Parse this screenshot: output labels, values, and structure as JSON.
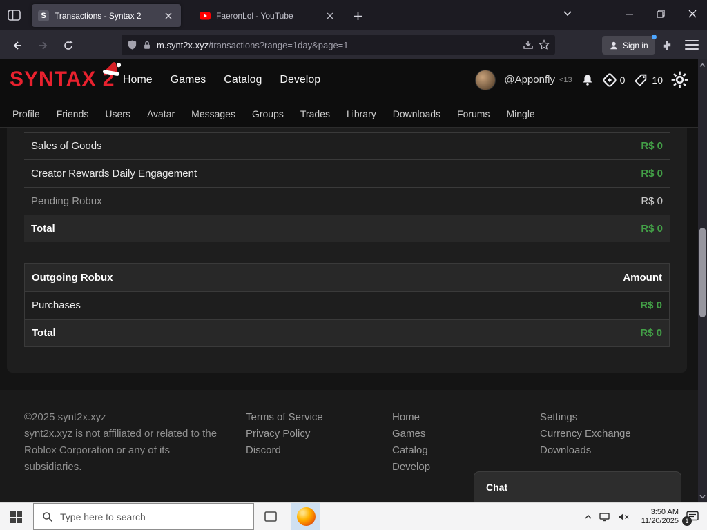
{
  "browser": {
    "tab1": {
      "favicon_letter": "S",
      "title": "Transactions - Syntax 2"
    },
    "tab2": {
      "title": "FaeronLol - YouTube"
    },
    "url_domain": "m.synt2x.xyz",
    "url_path": "/transactions?range=1day&page=1",
    "sign_in": "Sign in"
  },
  "header": {
    "logo": "SYNTAX 2",
    "nav": [
      "Home",
      "Games",
      "Catalog",
      "Develop"
    ],
    "username": "@Apponfly",
    "age_badge": "<13",
    "robux_count": "0",
    "tix_count": "10"
  },
  "subnav": [
    "Profile",
    "Friends",
    "Users",
    "Avatar",
    "Messages",
    "Groups",
    "Trades",
    "Library",
    "Downloads",
    "Forums",
    "Mingle"
  ],
  "transactions": {
    "incoming": {
      "rows": [
        {
          "label": "Sales of Goods",
          "value": "R$ 0"
        },
        {
          "label": "Creator Rewards Daily Engagement",
          "value": "R$ 0"
        },
        {
          "label": "Pending Robux",
          "value": "R$ 0"
        },
        {
          "label": "Total",
          "value": "R$ 0"
        }
      ]
    },
    "outgoing": {
      "header": {
        "label": "Outgoing Robux",
        "amount": "Amount"
      },
      "rows": [
        {
          "label": "Purchases",
          "value": "R$ 0"
        },
        {
          "label": "Total",
          "value": "R$ 0"
        }
      ]
    }
  },
  "footer": {
    "copyright": "©2025 synt2x.xyz",
    "disclaimer": "synt2x.xyz is not affiliated or related to the Roblox Corporation or any of its subsidiaries.",
    "legal": [
      "Terms of Service",
      "Privacy Policy",
      "Discord"
    ],
    "site": [
      "Home",
      "Games",
      "Catalog",
      "Develop"
    ],
    "other": [
      "Settings",
      "Currency Exchange",
      "Downloads"
    ]
  },
  "chat": {
    "title": "Chat"
  },
  "taskbar": {
    "search_placeholder": "Type here to search",
    "time": "3:50 AM",
    "date": "11/20/2025",
    "notification_badge": "1"
  },
  "colors": {
    "brand_red": "#e8212e",
    "money_green": "#43a047"
  }
}
